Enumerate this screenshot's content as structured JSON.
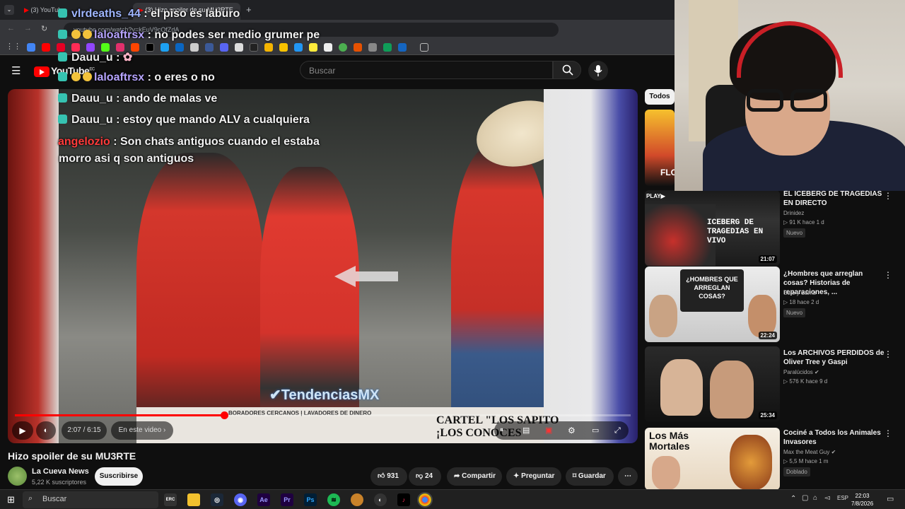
{
  "browser": {
    "tabs": [
      {
        "label": "(3) YouTube"
      },
      {
        "label": "(3) Hizo spoiler de su MU3RTE"
      }
    ],
    "url": "youtube.com/watch?v=kEuV9cQfZdA"
  },
  "youtube": {
    "logo": "YouTube",
    "country": "EC",
    "search_placeholder": "Buscar"
  },
  "chat": [
    {
      "user": "vlrdeaths_44",
      "message": "el piso es laburo",
      "color": "#9fb6ff"
    },
    {
      "user": "laloaftrsx",
      "message": "no podes ser medio grumer pe",
      "color": "#b6a4ff"
    },
    {
      "user": "Dauu_u",
      "message": "",
      "color": "#e8e8e8"
    },
    {
      "user": "laloaftrsx",
      "message": "o eres o no",
      "color": "#b6a4ff"
    },
    {
      "user": "Dauu_u",
      "message": "ando de malas ve",
      "color": "#e8e8e8"
    },
    {
      "user": "Dauu_u",
      "message": "estoy que mando ALV a cualquiera",
      "color": "#e8e8e8"
    },
    {
      "user": "angelozio",
      "message": "Son chats antiguos cuando el estaba",
      "color": "#ff3b3b"
    },
    {
      "user": "",
      "message": "morro asi q son antiguos",
      "color": "#ffffff"
    }
  ],
  "player": {
    "watermark": "TendenciasMX",
    "banner_text": "CARTEL \"LOS SAPITO",
    "banner_text2": "¡LOS CONOCES",
    "banner_small": "BORADORES CERCANOS | LAVADORES DE DINERO",
    "time": "2:07 / 6:15",
    "in_video": "En este video",
    "progress": 0.34
  },
  "video": {
    "title": "Hizo spoiler de su MU3RTE",
    "channel": "La Cueva News",
    "subscribers": "5,22 K suscriptores",
    "subscribe": "Suscribirse",
    "likes": "931",
    "dislikes": "24",
    "share": "Compartir",
    "ask": "Preguntar",
    "save": "Guardar"
  },
  "sidebar": {
    "chip": "Todos",
    "items": [
      {
        "title": "EL ICEBERG DE TRAGEDIAS EN DIRECTO",
        "channel": "Drinidez",
        "meta": "▷ 91 K  hace 1 d",
        "badge": "Nuevo",
        "duration": "21:07",
        "thumb_text": "ICEBERG DE TRAGEDIAS EN VIVO"
      },
      {
        "title": "¿Hombres que arreglan cosas? Historias de reparaciones, ...",
        "channel": "Soto y Samu",
        "meta": "▷ 18  hace 2 d",
        "badge": "Nuevo",
        "duration": "22:24",
        "thumb_text": "¿HOMBRES QUE ARREGLAN COSAS?"
      },
      {
        "title": "Los ARCHIVOS PERDIDOS de Oliver Tree y Gaspi",
        "channel": "Paralúcidos",
        "meta": "▷ 576 K  hace 9 d",
        "badge": "",
        "duration": "25:34",
        "thumb_text": ""
      },
      {
        "title": "Cociné a Todos los Animales Invasores",
        "channel": "Max the Meat Guy",
        "meta": "▷ 5,5 M  hace 1 m",
        "badge": "Doblado",
        "duration": "",
        "thumb_text": "Los Más Mortales"
      }
    ]
  },
  "taskbar": {
    "search": "Buscar",
    "lang": "ESP",
    "time": "22:03",
    "date": "7/8/2026"
  }
}
